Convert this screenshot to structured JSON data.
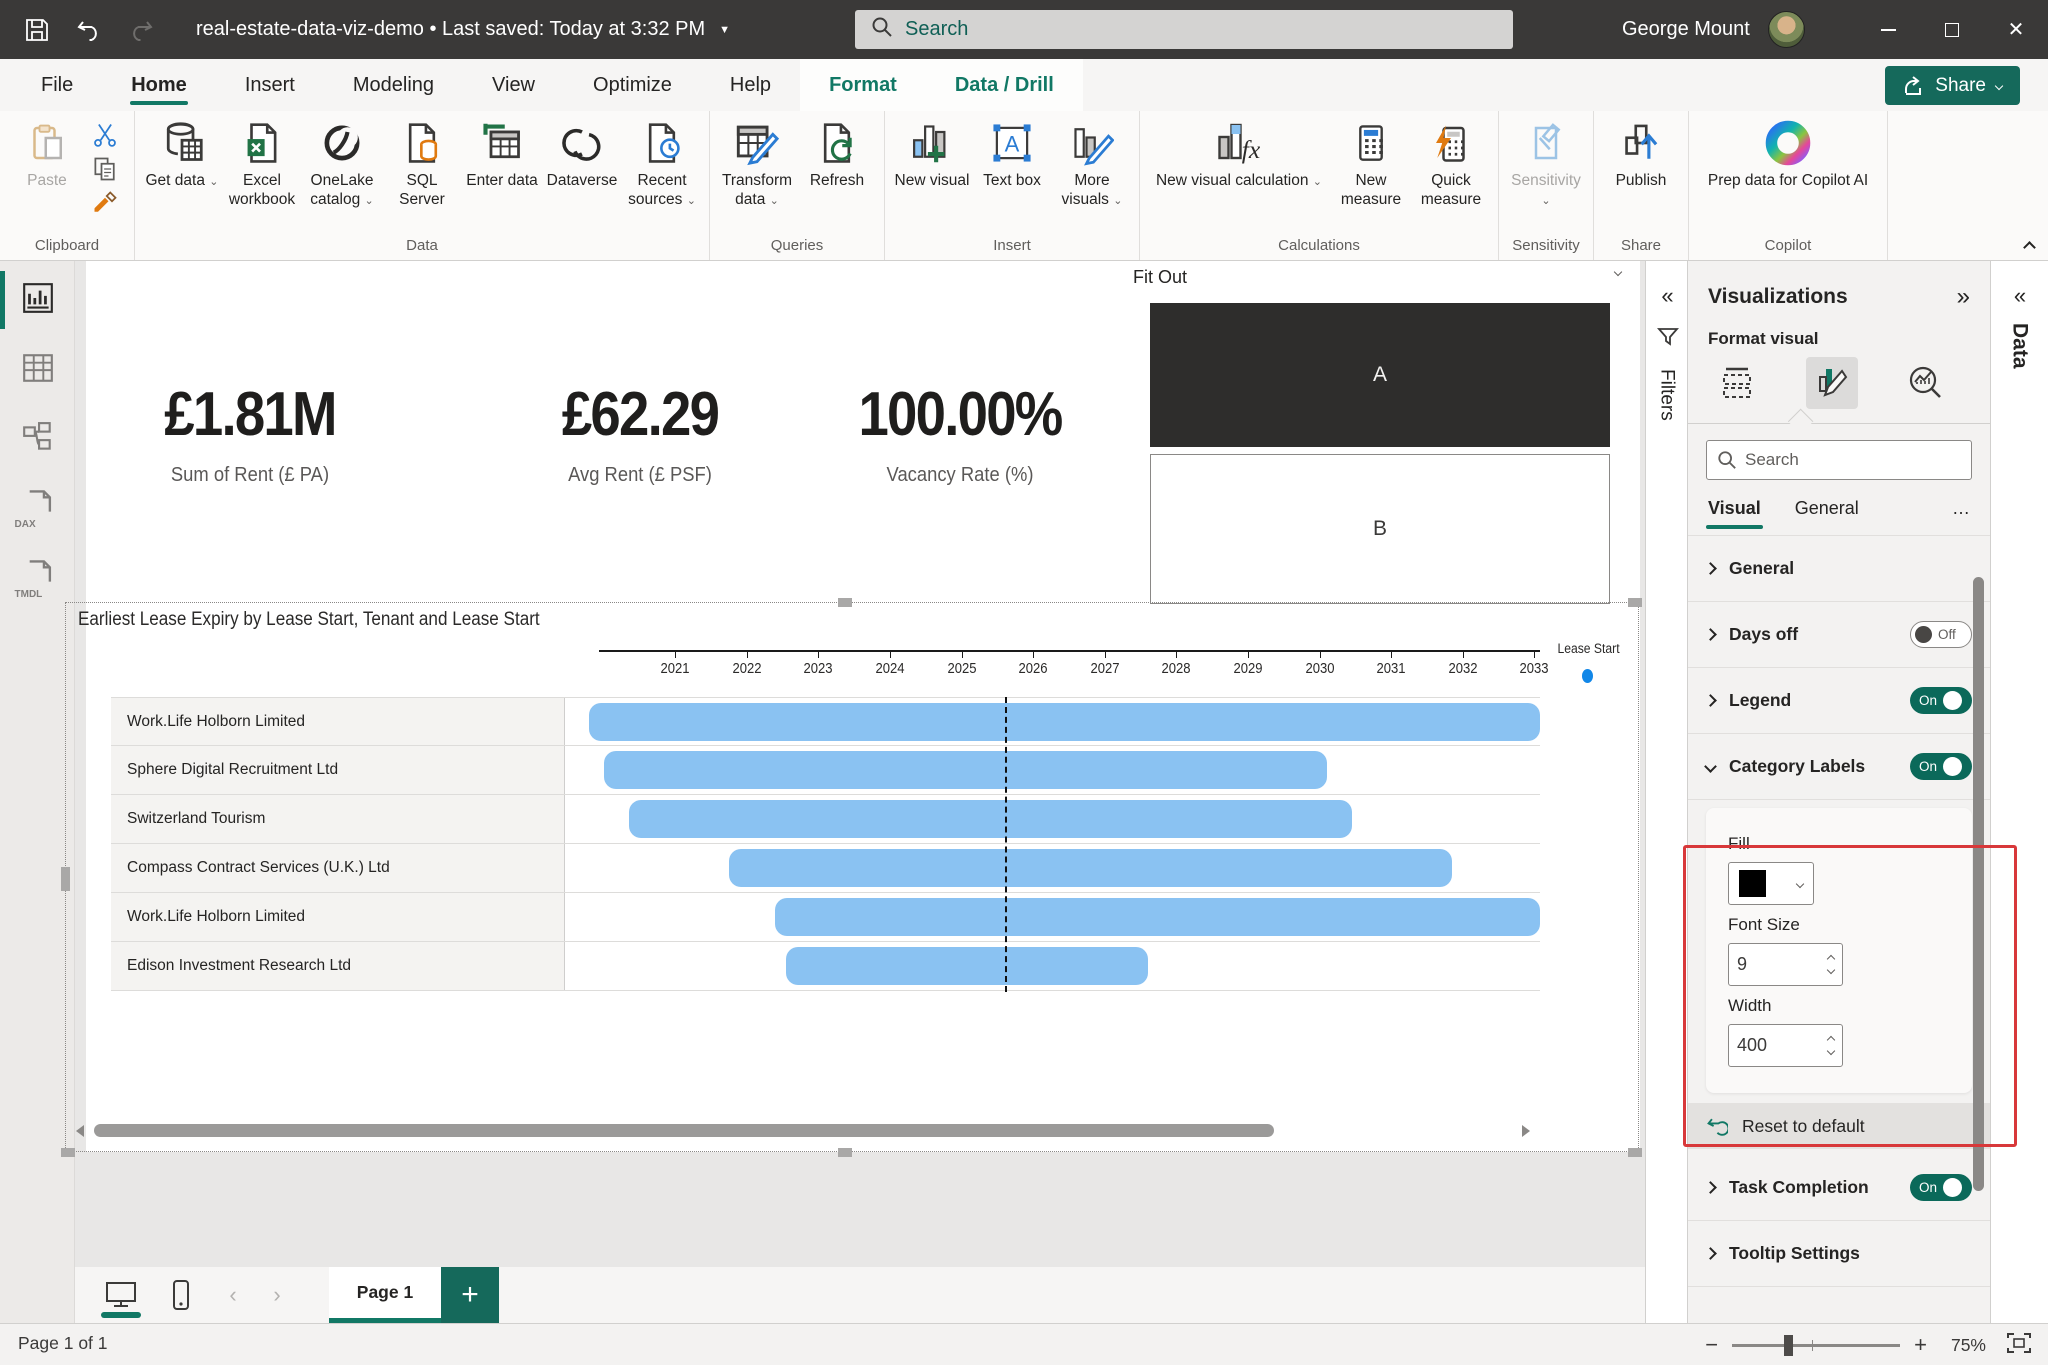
{
  "titlebar": {
    "file_name": "real-estate-data-viz-demo",
    "separator": "•",
    "saved_status": "Last saved: Today at 3:32 PM",
    "search_placeholder": "Search",
    "user_name": "George Mount"
  },
  "ribbon": {
    "tabs": [
      "File",
      "Home",
      "Insert",
      "Modeling",
      "View",
      "Optimize",
      "Help",
      "Format",
      "Data / Drill"
    ],
    "active_tab": "Home",
    "contextual_tabs": [
      "Format",
      "Data / Drill"
    ],
    "share_label": "Share",
    "groups": [
      {
        "label": "Clipboard",
        "buttons": [
          {
            "label": "Paste",
            "icon": "paste",
            "disabled": true
          }
        ],
        "small_icons": [
          "cut",
          "copy",
          "format-painter"
        ]
      },
      {
        "label": "Data",
        "buttons": [
          {
            "label": "Get data",
            "icon": "get-data",
            "caret": true
          },
          {
            "label": "Excel workbook",
            "icon": "excel"
          },
          {
            "label": "OneLake catalog",
            "icon": "onelake",
            "caret": true
          },
          {
            "label": "SQL Server",
            "icon": "sql-server"
          },
          {
            "label": "Enter data",
            "icon": "enter-data"
          },
          {
            "label": "Dataverse",
            "icon": "dataverse"
          },
          {
            "label": "Recent sources",
            "icon": "recent-sources",
            "caret": true
          }
        ]
      },
      {
        "label": "Queries",
        "buttons": [
          {
            "label": "Transform data",
            "icon": "transform-data",
            "caret": true
          },
          {
            "label": "Refresh",
            "icon": "refresh"
          }
        ]
      },
      {
        "label": "Insert",
        "buttons": [
          {
            "label": "New visual",
            "icon": "new-visual"
          },
          {
            "label": "Text box",
            "icon": "text-box"
          },
          {
            "label": "More visuals",
            "icon": "more-visuals",
            "caret": true
          }
        ]
      },
      {
        "label": "Calculations",
        "buttons": [
          {
            "label": "New visual calculation",
            "icon": "visual-calculation",
            "caret": true,
            "wide": true
          },
          {
            "label": "New measure",
            "icon": "new-measure"
          },
          {
            "label": "Quick measure",
            "icon": "quick-measure"
          }
        ]
      },
      {
        "label": "Sensitivity",
        "buttons": [
          {
            "label": "Sensitivity",
            "icon": "sensitivity",
            "caret": true,
            "disabled": true
          }
        ]
      },
      {
        "label": "Share",
        "buttons": [
          {
            "label": "Publish",
            "icon": "publish"
          }
        ]
      },
      {
        "label": "Copilot",
        "buttons": [
          {
            "label": "Prep data for Copilot AI",
            "icon": "copilot",
            "wide": true
          }
        ]
      }
    ]
  },
  "sidebar": {
    "items": [
      {
        "name": "report-view",
        "selected": true,
        "text": ""
      },
      {
        "name": "table-view",
        "selected": false,
        "text": ""
      },
      {
        "name": "model-view",
        "selected": false,
        "text": ""
      },
      {
        "name": "dax-query-view",
        "selected": false,
        "text": "DAX"
      },
      {
        "name": "tmdl-view",
        "selected": false,
        "text": "TMDL"
      }
    ]
  },
  "canvas": {
    "kpis": [
      {
        "value": "£1.81M",
        "label": "Sum of Rent (£ PA)"
      },
      {
        "value": "£62.29",
        "label": "Avg Rent (£ PSF)"
      },
      {
        "value": "100.00%",
        "label": "Vacancy Rate (%)"
      }
    ],
    "fit_out": {
      "title": "Fit Out",
      "options": [
        {
          "label": "A",
          "selected": true
        },
        {
          "label": "B",
          "selected": false
        }
      ]
    }
  },
  "chart_data": {
    "type": "bar",
    "subtype": "gantt",
    "title": "Earliest Lease Expiry by Lease Start, Tenant and Lease Start",
    "legend": {
      "label": "Lease Start",
      "position": "top-right",
      "marker_color": "#1187e8"
    },
    "bar_color": "#8ac2f2",
    "x_axis": {
      "ticks": [
        2021,
        2022,
        2023,
        2024,
        2025,
        2026,
        2027,
        2028,
        2029,
        2030,
        2031,
        2032,
        2033
      ],
      "domain": [
        2019.46,
        2033.08
      ],
      "units": "year"
    },
    "today_line_year": 2025.6,
    "rows": [
      {
        "tenant": "Work.Life Holborn Limited",
        "start": 2019.8,
        "end": 2033.08
      },
      {
        "tenant": "Sphere Digital Recruitment Ltd",
        "start": 2020.0,
        "end": 2030.1
      },
      {
        "tenant": "Switzerland Tourism",
        "start": 2020.35,
        "end": 2030.45
      },
      {
        "tenant": "Compass Contract Services (U.K.) Ltd",
        "start": 2021.75,
        "end": 2031.85
      },
      {
        "tenant": "Work.Life Holborn Limited",
        "start": 2022.4,
        "end": 2033.08
      },
      {
        "tenant": "Edison Investment Research Ltd",
        "start": 2022.55,
        "end": 2027.6
      }
    ]
  },
  "filters_panel": {
    "label": "Filters"
  },
  "visualizations_panel": {
    "title": "Visualizations",
    "subtitle": "Format visual",
    "search_placeholder": "Search",
    "tabs": [
      "Visual",
      "General",
      "…"
    ],
    "active_tab": "Visual",
    "sections_top": [
      {
        "label": "General",
        "toggle": null,
        "expanded": false
      },
      {
        "label": "Days off",
        "toggle": "Off",
        "expanded": false
      },
      {
        "label": "Legend",
        "toggle": "On",
        "expanded": false
      },
      {
        "label": "Category Labels",
        "toggle": "On",
        "expanded": true
      }
    ],
    "category_labels_card": {
      "fill_label": "Fill",
      "fill_value": "#000000",
      "font_size_label": "Font Size",
      "font_size_value": "9",
      "width_label": "Width",
      "width_value": "400"
    },
    "reset_label": "Reset to default",
    "sections_bottom": [
      {
        "label": "Task Completion",
        "toggle": "On",
        "expanded": false
      },
      {
        "label": "Tooltip Settings",
        "toggle": null,
        "expanded": false
      }
    ]
  },
  "data_panel": {
    "label": "Data"
  },
  "footer": {
    "page_tab": "Page 1",
    "status": "Page 1 of 1",
    "zoom_level": "75%"
  }
}
